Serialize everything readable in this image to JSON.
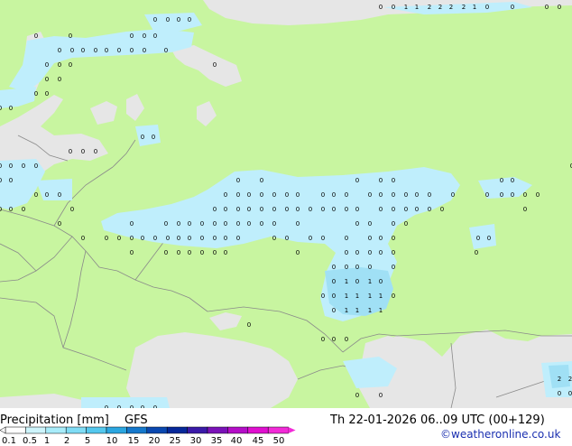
{
  "map": {
    "colors": {
      "sea": "#e6e6e6",
      "land": "#c8f5a0",
      "precip_light": "#bfeefc",
      "precip_medium": "#a0e0f5",
      "border": "#8a8a8a",
      "marker": "#000000"
    },
    "precip_values_shown": [
      "0",
      "1",
      "2"
    ]
  },
  "footer": {
    "title": "Precipitation [mm]",
    "model": "GFS",
    "datetime": "Th 22-01-2026 06..09 UTC (00+129)",
    "credit": "©weatheronline.co.uk"
  },
  "legend": {
    "ticks": [
      "0.1",
      "0.5",
      "1",
      "2",
      "5",
      "10",
      "15",
      "20",
      "25",
      "30",
      "35",
      "40",
      "45",
      "50"
    ],
    "colors": [
      "#fefefe",
      "#cdf4fb",
      "#a8ecfa",
      "#7fdcf5",
      "#54c8ee",
      "#2ba6e0",
      "#1578cc",
      "#0a48b0",
      "#06289a",
      "#3a1aa8",
      "#7a12b8",
      "#b40ec8",
      "#e010d0",
      "#f22ad8"
    ]
  }
}
